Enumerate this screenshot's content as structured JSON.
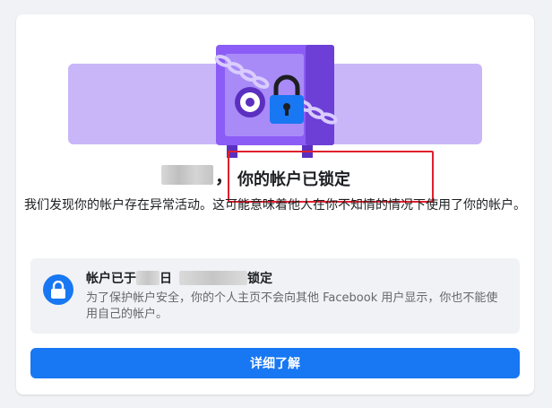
{
  "header": {
    "title_comma": "，",
    "title": "你的帐户已锁定"
  },
  "body": {
    "message": "我们发现你的帐户存在异常活动。这可能意味着他人在你不知情的情况下使用了你的帐户。"
  },
  "notice": {
    "title_prefix": "帐户已于",
    "title_mid": "日",
    "title_suffix": "锁定",
    "description": "为了保护帐户安全，你的个人主页不会向其他 Facebook 用户显示，你也不能使用自己的帐户。",
    "icon": "lock-icon"
  },
  "actions": {
    "learn_more_label": "详细了解"
  },
  "colors": {
    "accent": "#1877f2",
    "safe_purple": "#8b5cf6",
    "highlight": "#e0202e"
  }
}
